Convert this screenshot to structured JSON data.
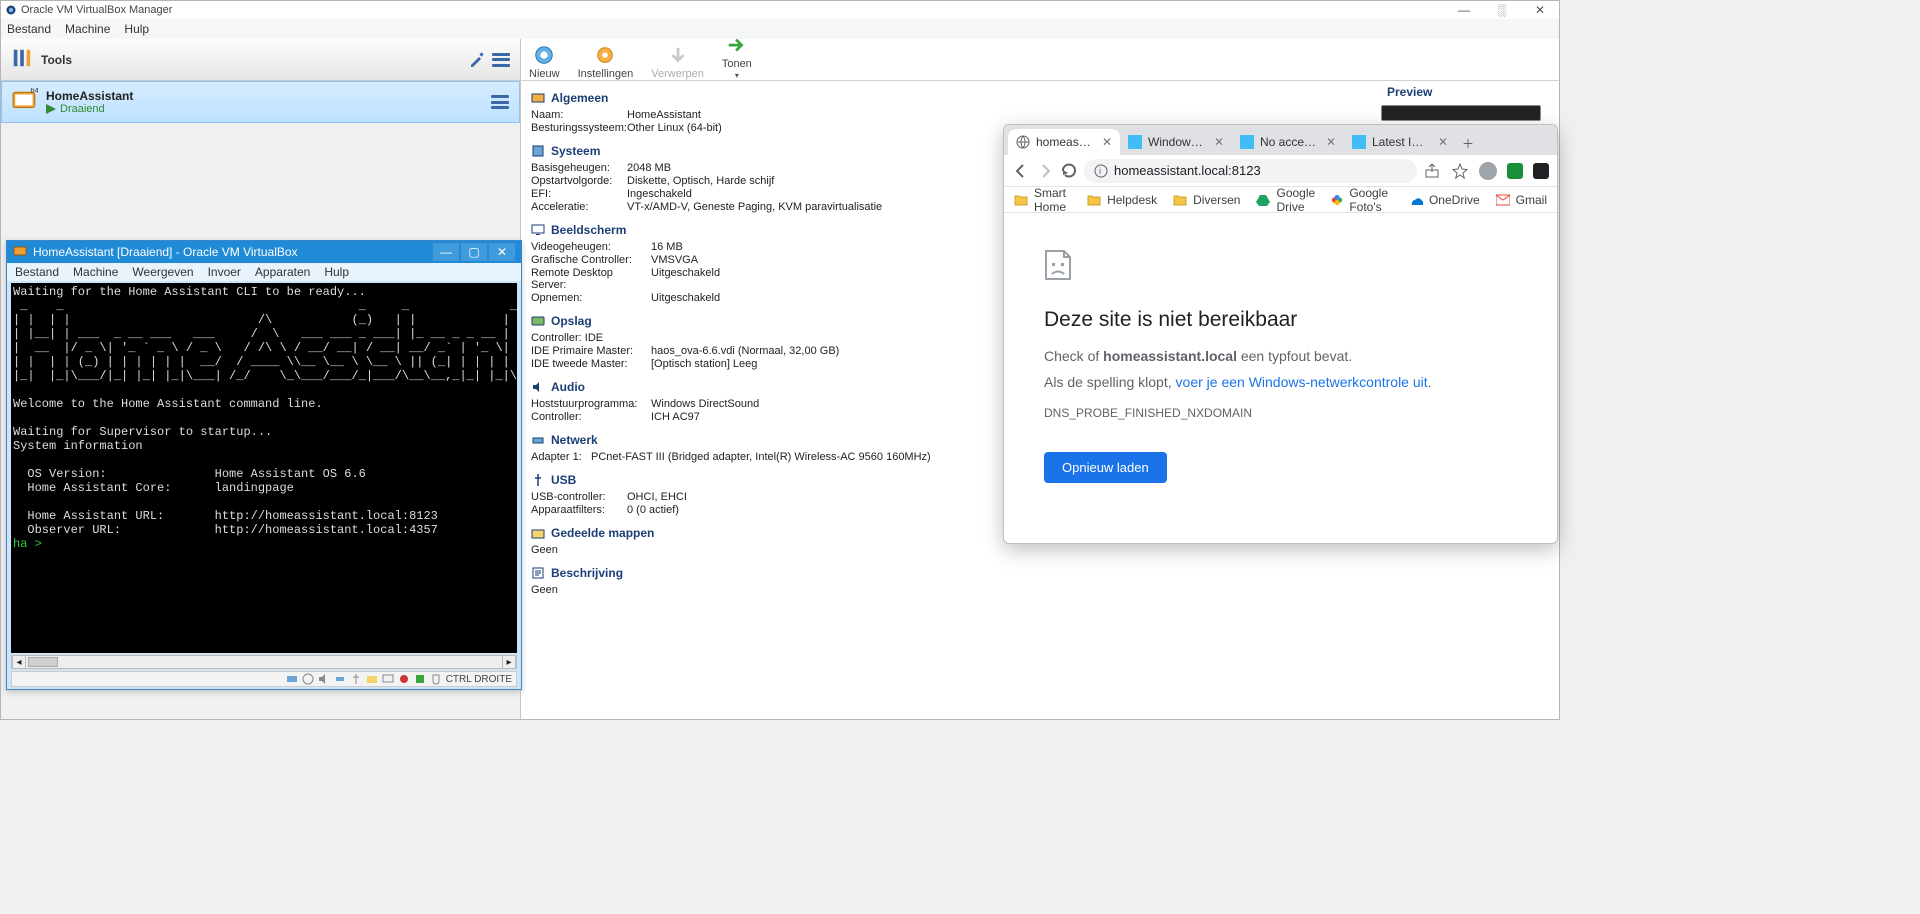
{
  "vbmgr": {
    "title": "Oracle VM VirtualBox Manager",
    "menu": {
      "file": "Bestand",
      "machine": "Machine",
      "help": "Hulp"
    },
    "tools_label": "Tools",
    "vm": {
      "name": "HomeAssistant",
      "state": "Draaiend"
    },
    "toolbar": {
      "new": "Nieuw",
      "settings": "Instellingen",
      "discard": "Verwerpen",
      "show": "Tonen"
    },
    "preview_label": "Preview",
    "sections": {
      "general": {
        "title": "Algemeen",
        "rows": [
          {
            "k": "Naam:",
            "v": "HomeAssistant"
          },
          {
            "k": "Besturingssysteem:",
            "v": "Other Linux (64-bit)"
          }
        ]
      },
      "system": {
        "title": "Systeem",
        "rows": [
          {
            "k": "Basisgeheugen:",
            "v": "2048 MB"
          },
          {
            "k": "Opstartvolgorde:",
            "v": "Diskette, Optisch, Harde schijf"
          },
          {
            "k": "EFI:",
            "v": "Ingeschakeld"
          },
          {
            "k": "Acceleratie:",
            "v": "VT-x/AMD-V, Geneste Paging, KVM paravirtualisatie"
          }
        ]
      },
      "display": {
        "title": "Beeldscherm",
        "rows": [
          {
            "k": "Videogeheugen:",
            "v": "16 MB"
          },
          {
            "k": "Grafische Controller:",
            "v": "VMSVGA"
          },
          {
            "k": "Remote Desktop Server:",
            "v": "Uitgeschakeld"
          },
          {
            "k": "Opnemen:",
            "v": "Uitgeschakeld"
          }
        ]
      },
      "storage": {
        "title": "Opslag",
        "rows": [
          {
            "k": "Controller: IDE",
            "v": ""
          },
          {
            "k": "IDE Primaire Master:",
            "v": "haos_ova-6.6.vdi (Normaal, 32,00 GB)"
          },
          {
            "k": "IDE tweede Master:",
            "v": "[Optisch station] Leeg"
          }
        ]
      },
      "audio": {
        "title": "Audio",
        "rows": [
          {
            "k": "Hoststuurprogramma:",
            "v": "Windows DirectSound"
          },
          {
            "k": "Controller:",
            "v": "ICH AC97"
          }
        ]
      },
      "network": {
        "title": "Netwerk",
        "rows": [
          {
            "k": "Adapter 1:",
            "v": "PCnet-FAST III (Bridged adapter, Intel(R) Wireless-AC 9560 160MHz)"
          }
        ]
      },
      "usb": {
        "title": "USB",
        "rows": [
          {
            "k": "USB-controller:",
            "v": "OHCI, EHCI"
          },
          {
            "k": "Apparaatfilters:",
            "v": "0 (0 actief)"
          }
        ]
      },
      "shared": {
        "title": "Gedeelde mappen",
        "value": "Geen"
      },
      "desc": {
        "title": "Beschrijving",
        "value": "Geen"
      }
    }
  },
  "vmcon": {
    "title": "HomeAssistant [Draaiend] - Oracle VM VirtualBox",
    "menu": {
      "file": "Bestand",
      "machine": "Machine",
      "view": "Weergeven",
      "input": "Invoer",
      "devices": "Apparaten",
      "help": "Hulp"
    },
    "lines": {
      "l1": "Waiting for the Home Assistant CLI to be ready...",
      "ascii": " _    _                                         _     _              _\n| |  | |                          /\\           (_)   | |            | |\n| |__| | ___  _ __ ___   ___     /  \\   ___ ___ _ ___| |_ __ _ _ __ | |_\n|  __  |/ _ \\| '_ ` _ \\ / _ \\   / /\\ \\ / __/ __| / __| __/ _` | '_ \\| __|\n| |  | | (_) | | | | | |  __/  / ____ \\\\__ \\__ \\ \\__ \\ || (_| | | | | |_\n|_|  |_|\\___/|_| |_| |_|\\___| /_/    \\_\\___/___/_|___/\\__\\__,_|_| |_|\\__|",
      "l2": "Welcome to the Home Assistant command line.",
      "l3": "Waiting for Supervisor to startup...",
      "l4": "System information",
      "l5": "  OS Version:               Home Assistant OS 6.6",
      "l6": "  Home Assistant Core:      landingpage",
      "l7": "  Home Assistant URL:       http://homeassistant.local:8123",
      "l8": "  Observer URL:             http://homeassistant.local:4357",
      "prompt": "ha >"
    },
    "status_hostkey": "CTRL DROITE"
  },
  "chrome": {
    "tabs": [
      {
        "label": "homeassistant",
        "active": true
      },
      {
        "label": "Windows - H",
        "active": false
      },
      {
        "label": "No access of",
        "active": false
      },
      {
        "label": "Latest Install",
        "active": false
      }
    ],
    "url": "homeassistant.local:8123",
    "bookmarks": [
      {
        "label": "Smart Home",
        "type": "folder"
      },
      {
        "label": "Helpdesk",
        "type": "folder"
      },
      {
        "label": "Diversen",
        "type": "folder"
      },
      {
        "label": "Google Drive",
        "type": "drive"
      },
      {
        "label": "Google Foto's",
        "type": "photos"
      },
      {
        "label": "OneDrive",
        "type": "onedrive"
      },
      {
        "label": "Gmail",
        "type": "gmail"
      }
    ],
    "error": {
      "heading": "Deze site is niet bereikbaar",
      "line1_a": "Check of ",
      "line1_b": "homeassistant.local",
      "line1_c": " een typfout bevat.",
      "line2_a": "Als de spelling klopt, ",
      "line2_link": "voer je een Windows-netwerkcontrole uit",
      "line2_b": ".",
      "code": "DNS_PROBE_FINISHED_NXDOMAIN",
      "reload": "Opnieuw laden"
    }
  }
}
